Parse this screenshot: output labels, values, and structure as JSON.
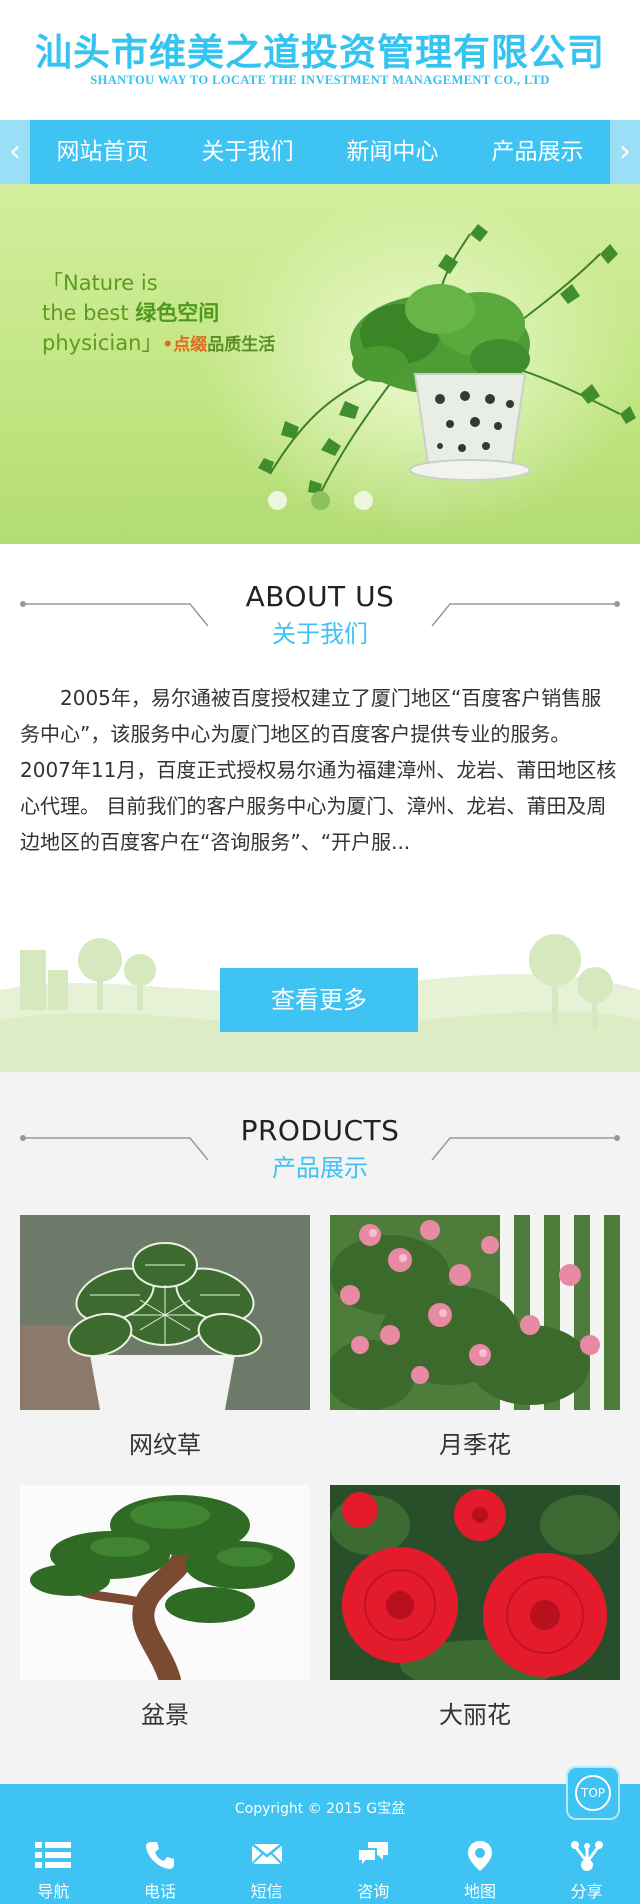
{
  "header": {
    "company_cn": "汕头市维美之道投资管理有限公司",
    "company_en": "SHANTOU WAY TO LOCATE THE INVESTMENT MANAGEMENT CO., LTD"
  },
  "nav": {
    "items": [
      {
        "label": "网站首页"
      },
      {
        "label": "关于我们"
      },
      {
        "label": "新闻中心"
      },
      {
        "label": "产品展示"
      }
    ],
    "prev_glyph": "‹",
    "next_glyph": "›"
  },
  "banner": {
    "slogan_line1": "Nature is",
    "slogan_line2_en": "the best ",
    "slogan_line2_cn": "绿色空间",
    "slogan_line3_en": "physician",
    "slogan_line3_dot": "•",
    "slogan_line3_cn_orange": "点缀",
    "slogan_line3_cn": "品质生活",
    "bracket_open": "「",
    "bracket_close": "」",
    "slides_total": 3,
    "active_slide": 2
  },
  "about": {
    "title_en": "ABOUT US",
    "title_cn": "关于我们",
    "body": "2005年，易尔通被百度授权建立了厦门地区“百度客户销售服务中心”，该服务中心为厦门地区的百度客户提供专业的服务。2007年11月，百度正式授权易尔通为福建漳州、龙岩、莆田地区核心代理。 目前我们的客户服务中心为厦门、漳州、龙岩、莆田及周边地区的百度客户在“咨询服务”、“开户服...",
    "more_label": "查看更多"
  },
  "products": {
    "title_en": "PRODUCTS",
    "title_cn": "产品展示",
    "items": [
      {
        "name": "网纹草"
      },
      {
        "name": "月季花"
      },
      {
        "name": "盆景"
      },
      {
        "name": "大丽花"
      }
    ]
  },
  "footer": {
    "copyright": "Copyright © 2015 G宝盆",
    "top_label": "TOP"
  },
  "bottom_bar": {
    "items": [
      {
        "label": "导航",
        "icon": "menu-icon"
      },
      {
        "label": "电话",
        "icon": "phone-icon"
      },
      {
        "label": "短信",
        "icon": "mail-icon"
      },
      {
        "label": "咨询",
        "icon": "chat-icon"
      },
      {
        "label": "地图",
        "icon": "map-pin-icon"
      },
      {
        "label": "分享",
        "icon": "share-icon"
      }
    ]
  },
  "colors": {
    "accent": "#3ec3f2",
    "banner_green": "#c2e684"
  }
}
